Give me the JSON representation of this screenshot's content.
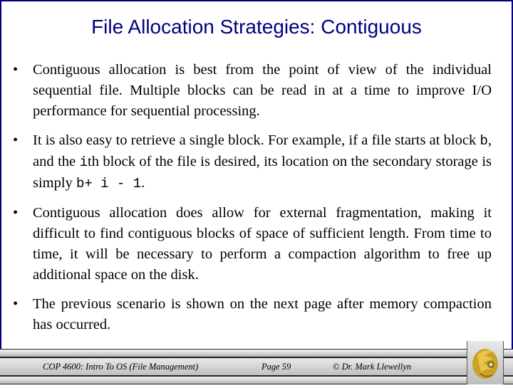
{
  "slide": {
    "title": "File Allocation Strategies: Contiguous",
    "bullets": [
      {
        "segments": [
          {
            "text": "Contiguous allocation is best from the point of view of the individual sequential file.  Multiple blocks can be read in at a time to improve I/O performance for sequential processing.",
            "mono": false
          }
        ]
      },
      {
        "segments": [
          {
            "text": "It is also easy to retrieve a single block.  For example, if a file starts at block ",
            "mono": false
          },
          {
            "text": "b",
            "mono": true
          },
          {
            "text": ", and the ",
            "mono": false
          },
          {
            "text": "i",
            "mono": true
          },
          {
            "text": "th block of the file is desired, its location on the secondary storage is simply ",
            "mono": false
          },
          {
            "text": "b+ i - 1",
            "mono": true
          },
          {
            "text": ".",
            "mono": false
          }
        ]
      },
      {
        "segments": [
          {
            "text": "Contiguous allocation does allow for external fragmentation, making it difficult to find contiguous blocks of space of sufficient length.  From time to time, it will be necessary to perform a compaction algorithm to free up additional space on the disk.",
            "mono": false
          }
        ]
      },
      {
        "segments": [
          {
            "text": "The previous scenario is shown on the next page after memory compaction has occurred.",
            "mono": false
          }
        ]
      }
    ],
    "bullet_glyph": "•"
  },
  "footer": {
    "course": "COP 4600: Intro To OS  (File Management)",
    "page": "Page 59",
    "author": "© Dr. Mark Llewellyn",
    "logo_icon": "pegasus-logo"
  },
  "colors": {
    "title": "#000080",
    "border": "#000080",
    "logo_gold": "#c9a227"
  }
}
